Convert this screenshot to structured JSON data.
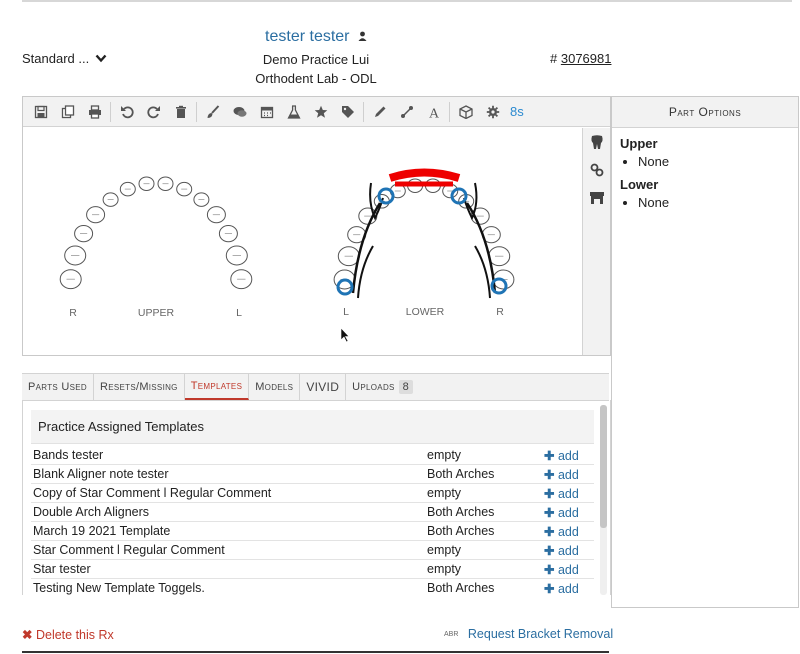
{
  "patient": {
    "name": "tester tester",
    "practice": "Demo Practice Lui",
    "lab": "Orthodent Lab - ODL"
  },
  "header": {
    "template_select": "Standard ...",
    "rx_prefix": "#",
    "rx_number": "3076981"
  },
  "toolbar": {
    "timer": "8s"
  },
  "chart": {
    "upper": {
      "left": "R",
      "center": "UPPER",
      "right": "L"
    },
    "lower": {
      "left": "L",
      "center": "LOWER",
      "right": "R"
    }
  },
  "part_options": {
    "title": "Part Options",
    "sections": [
      {
        "name": "Upper",
        "items": [
          "None"
        ]
      },
      {
        "name": "Lower",
        "items": [
          "None"
        ]
      }
    ]
  },
  "tabs": [
    {
      "label": "Parts Used"
    },
    {
      "label": "Resets/Missing"
    },
    {
      "label": "Templates",
      "active": true
    },
    {
      "label": "Models"
    },
    {
      "label": "VIVID"
    },
    {
      "label": "Uploads",
      "badge": "8"
    }
  ],
  "templates": {
    "heading": "Practice Assigned Templates",
    "add_label": "add",
    "rows": [
      {
        "name": "Bands tester",
        "arch": "empty"
      },
      {
        "name": "Blank Aligner note tester",
        "arch": "Both Arches"
      },
      {
        "name": "Copy of Star Comment l Regular Comment",
        "arch": "empty"
      },
      {
        "name": "Double Arch Aligners",
        "arch": "Both Arches"
      },
      {
        "name": "March 19 2021 Template",
        "arch": "Both Arches"
      },
      {
        "name": "Star Comment l Regular Comment",
        "arch": "empty"
      },
      {
        "name": "Star tester",
        "arch": "empty"
      },
      {
        "name": "Testing New Template Toggels.",
        "arch": "Both Arches"
      }
    ]
  },
  "footer": {
    "delete": "Delete this Rx",
    "abr": "ABR",
    "request": "Request Bracket Removal"
  },
  "colors": {
    "link": "#2b6ea1",
    "danger": "#c0392b",
    "accent": "#2b8ad0"
  }
}
